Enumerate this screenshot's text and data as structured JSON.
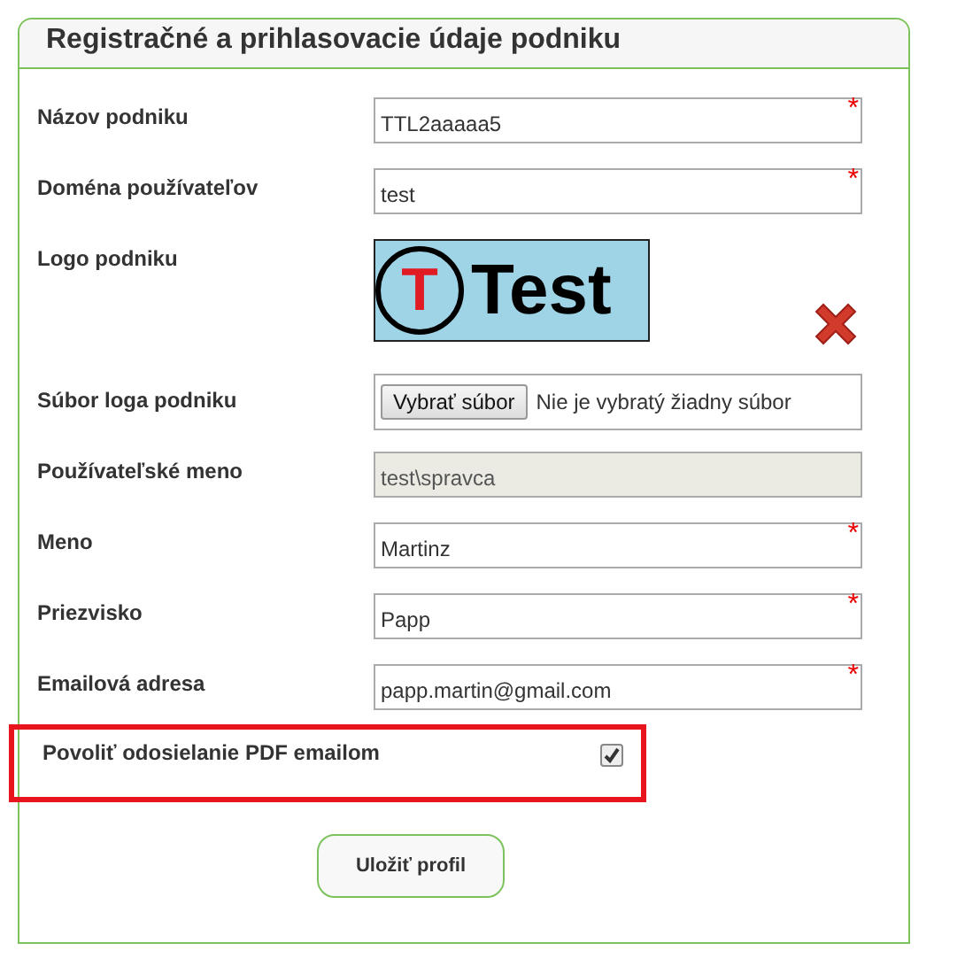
{
  "panel": {
    "title": "Registračné a prihlasovacie údaje podniku"
  },
  "rows": [
    {
      "kind": "text",
      "label": "Názov podniku",
      "value": "TTL2aaaaa5",
      "required_mark": "*",
      "disabled": false
    },
    {
      "kind": "text",
      "label": "Doména používateľov",
      "value": "test",
      "required_mark": "*",
      "disabled": false
    },
    {
      "kind": "logo",
      "label": "Logo podniku",
      "logo_letter": "T",
      "logo_text": "Test"
    },
    {
      "kind": "file",
      "label": "Súbor loga podniku",
      "button": "Vybrať súbor",
      "status": "Nie je vybratý žiadny súbor"
    },
    {
      "kind": "text",
      "label": "Používateľské meno",
      "value": "test\\spravca",
      "disabled": true
    },
    {
      "kind": "text",
      "label": "Meno",
      "value": "Martinz",
      "required_mark": "*",
      "disabled": false
    },
    {
      "kind": "text",
      "label": "Priezvisko",
      "value": "Papp",
      "required_mark": "*",
      "disabled": false
    },
    {
      "kind": "text",
      "label": "Emailová adresa",
      "value": "papp.martin@gmail.com",
      "required_mark": "*",
      "disabled": false
    },
    {
      "kind": "checkbox",
      "label": "Povoliť odosielanie PDF emailom",
      "checked": true,
      "highlighted": true
    }
  ],
  "save_button": "Uložiť profil"
}
